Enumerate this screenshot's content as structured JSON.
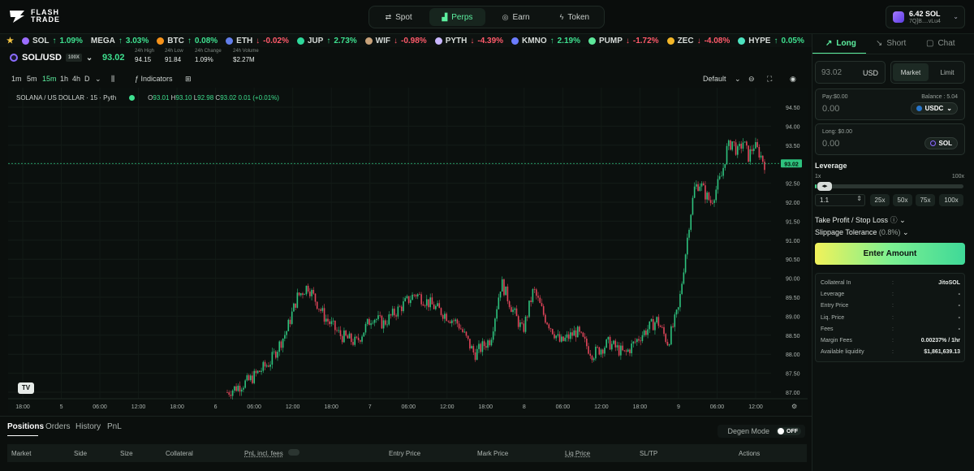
{
  "brand": {
    "line1": "FLASH",
    "line2": "TRADE"
  },
  "nav": {
    "tabs": [
      {
        "label": "Spot",
        "icon": "swap-icon"
      },
      {
        "label": "Perps",
        "icon": "chart-icon"
      },
      {
        "label": "Earn",
        "icon": "coins-icon"
      },
      {
        "label": "Token",
        "icon": "bolt-icon"
      }
    ]
  },
  "wallet": {
    "balance": "6.42 SOL",
    "address": "7Q]B....vLu4"
  },
  "ticker": [
    {
      "symbol": "SOL",
      "change": "1.09%",
      "dir": "up",
      "color": "#9b6dff"
    },
    {
      "symbol": "MEGA",
      "change": "3.03%",
      "dir": "up",
      "color": ""
    },
    {
      "symbol": "BTC",
      "change": "0.08%",
      "dir": "up",
      "color": "#f7931a"
    },
    {
      "symbol": "ETH",
      "change": "-0.02%",
      "dir": "down",
      "color": "#627eea"
    },
    {
      "symbol": "JUP",
      "change": "2.73%",
      "dir": "up",
      "color": "#2fd99b"
    },
    {
      "symbol": "WIF",
      "change": "-0.98%",
      "dir": "down",
      "color": "#c8a27a"
    },
    {
      "symbol": "PYTH",
      "change": "-4.39%",
      "dir": "down",
      "color": "#c9b7ff"
    },
    {
      "symbol": "KMNO",
      "change": "2.19%",
      "dir": "up",
      "color": "#6b7cff"
    },
    {
      "symbol": "PUMP",
      "change": "-1.72%",
      "dir": "down",
      "color": "#5de89a"
    },
    {
      "symbol": "ZEC",
      "change": "-4.08%",
      "dir": "down",
      "color": "#f4b728"
    },
    {
      "symbol": "HYPE",
      "change": "0.05%",
      "dir": "up",
      "color": "#4de3c0"
    }
  ],
  "market": {
    "symbol": "SOL/USD",
    "leverage": "100X",
    "price": "93.02",
    "stats": [
      {
        "label": "24h High",
        "value": "94.15"
      },
      {
        "label": "24h Low",
        "value": "91.84"
      },
      {
        "label": "24h Change",
        "value": "1.09%"
      },
      {
        "label": "24h Volume",
        "value": "$2.27M"
      }
    ]
  },
  "toolbar": {
    "timeframes": [
      "1m",
      "5m",
      "15m",
      "1h",
      "4h",
      "D"
    ],
    "active_tf": "15m",
    "indicators": "Indicators",
    "layout": "Default"
  },
  "legend": {
    "title": "SOLANA / US DOLLAR · 15 · Pyth",
    "o": "93.01",
    "h": "93.10",
    "l": "92.98",
    "c": "93.02",
    "change": "0.01 (+0.01%)"
  },
  "chart_data": {
    "type": "candlestick",
    "yticks": [
      "94.50",
      "94.00",
      "93.50",
      "93.00",
      "92.50",
      "92.00",
      "91.50",
      "91.00",
      "90.50",
      "90.00",
      "89.50",
      "89.00",
      "88.50",
      "88.00",
      "87.50",
      "87.00"
    ],
    "ylim": [
      87.0,
      94.5
    ],
    "xticks": [
      "18:00",
      "5",
      "06:00",
      "12:00",
      "18:00",
      "6",
      "06:00",
      "12:00",
      "18:00",
      "7",
      "06:00",
      "12:00",
      "18:00",
      "8",
      "06:00",
      "12:00",
      "18:00",
      "9",
      "06:00",
      "12:00"
    ],
    "last_price": "93.02",
    "close_path": [
      [
        0,
        87.0
      ],
      [
        4,
        87.3
      ],
      [
        8,
        87.8
      ],
      [
        11,
        88.6
      ],
      [
        13,
        89.5
      ],
      [
        15,
        89.8
      ],
      [
        18,
        89.0
      ],
      [
        21,
        88.5
      ],
      [
        24,
        88.3
      ],
      [
        27,
        89.0
      ],
      [
        29,
        88.8
      ],
      [
        32,
        89.2
      ],
      [
        35,
        89.6
      ],
      [
        38,
        89.3
      ],
      [
        41,
        89.0
      ],
      [
        43,
        88.8
      ],
      [
        46,
        88.0
      ],
      [
        49,
        88.4
      ],
      [
        51,
        89.9
      ],
      [
        53,
        89.2
      ],
      [
        55,
        88.6
      ],
      [
        57,
        89.7
      ],
      [
        59,
        89.0
      ],
      [
        62,
        88.3
      ],
      [
        65,
        88.6
      ],
      [
        68,
        88.0
      ],
      [
        71,
        88.3
      ],
      [
        74,
        88.0
      ],
      [
        77,
        88.5
      ],
      [
        80,
        88.9
      ],
      [
        82,
        88.3
      ],
      [
        84,
        89.2
      ],
      [
        86,
        91.5
      ],
      [
        87,
        92.4
      ],
      [
        88,
        92.5
      ],
      [
        89,
        92.2
      ],
      [
        90,
        92.0
      ],
      [
        92,
        92.7
      ],
      [
        93,
        93.4
      ],
      [
        94,
        93.6
      ],
      [
        95,
        93.3
      ],
      [
        96,
        93.6
      ],
      [
        97,
        93.2
      ],
      [
        98,
        93.5
      ],
      [
        99,
        93.3
      ],
      [
        100,
        93.02
      ]
    ]
  },
  "bottom": {
    "tabs": [
      "Positions",
      "Orders",
      "History",
      "PnL"
    ],
    "degen_label": "Degen Mode",
    "degen_state": "OFF",
    "columns": [
      "Market",
      "Side",
      "Size",
      "Collateral",
      "PnL incl. fees",
      "Entry Price",
      "Mark Price",
      "Liq Price",
      "SL/TP",
      "Actions"
    ]
  },
  "order": {
    "tabs": [
      "Long",
      "Short",
      "Chat"
    ],
    "price_value": "93.02",
    "price_unit": "USD",
    "types": [
      "Market",
      "Limit"
    ],
    "pay_label": "Pay:$0.00",
    "balance_label": "Balance : 5.04",
    "pay_value": "0.00",
    "pay_token": "USDC",
    "long_label": "Long: $0.00",
    "long_value": "0.00",
    "long_token": "SOL",
    "leverage_title": "Leverage",
    "lev_min": "1x",
    "lev_max": "100x",
    "lev_value": "1.1",
    "lev_presets": [
      "25x",
      "50x",
      "75x",
      "100x"
    ],
    "tpsl": "Take Profit / Stop Loss",
    "slippage": "Slippage Tolerance",
    "slippage_value": "(0.8%)",
    "enter": "Enter Amount",
    "summary": [
      {
        "label": "Collateral In",
        "value": "JitoSOL"
      },
      {
        "label": "Leverage",
        "value": "-"
      },
      {
        "label": "Entry Price",
        "value": "-"
      },
      {
        "label": "Liq. Price",
        "value": "-"
      },
      {
        "label": "Fees",
        "value": "-"
      },
      {
        "label": "Margin Fees",
        "value": "0.00237% / 1hr"
      },
      {
        "label": "Available liquidity",
        "value": "$1,861,639.13"
      }
    ]
  }
}
